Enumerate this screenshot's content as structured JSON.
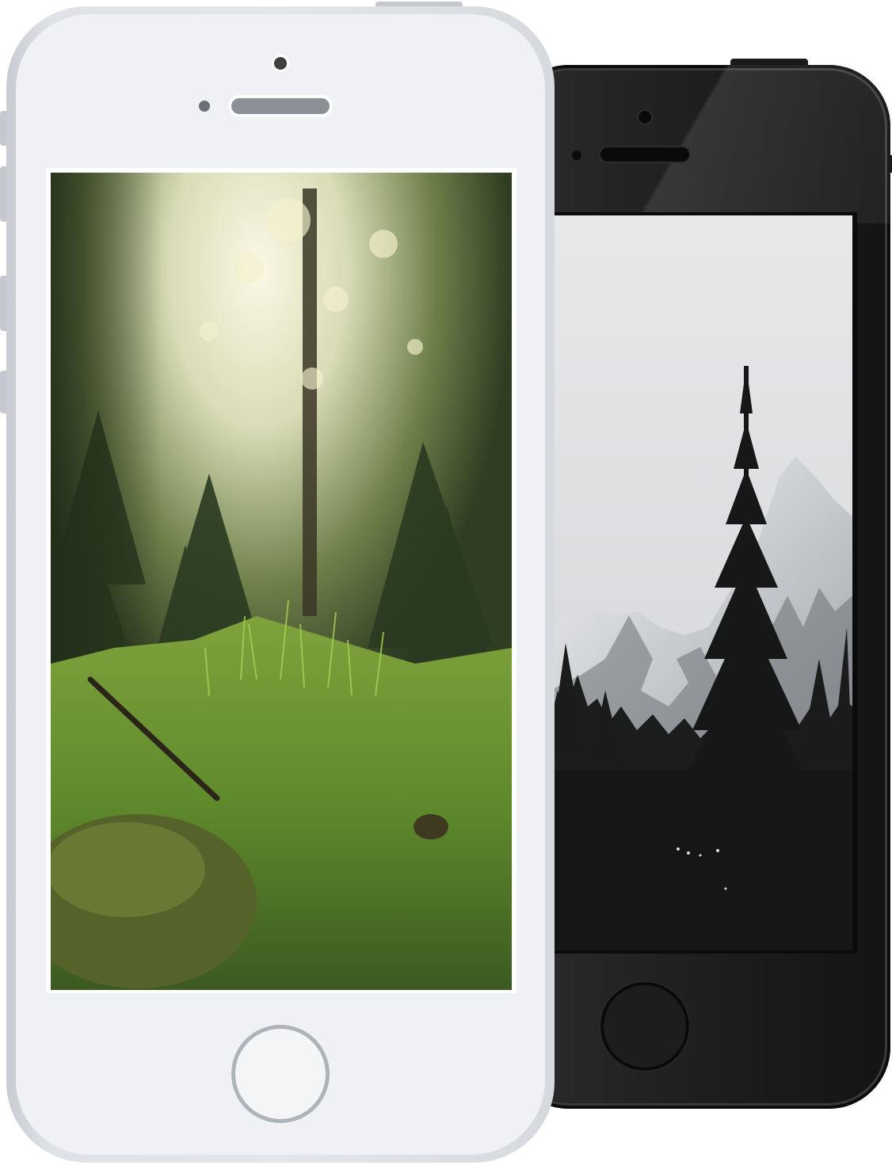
{
  "scene": {
    "phones": [
      {
        "label": "white-phone",
        "color": "#eef0f3",
        "wallpaper": {
          "subject": "forest",
          "colors": [
            "#f3f1dc",
            "#6f8d3b",
            "#2b3a1f",
            "#9cbf4a"
          ]
        }
      },
      {
        "label": "black-phone",
        "color": "#1c1c1e",
        "wallpaper": {
          "subject": "mountain",
          "colors": [
            "#e5e6e8",
            "#b9bcc0",
            "#1a1c1b",
            "#ffffff"
          ]
        }
      }
    ]
  }
}
